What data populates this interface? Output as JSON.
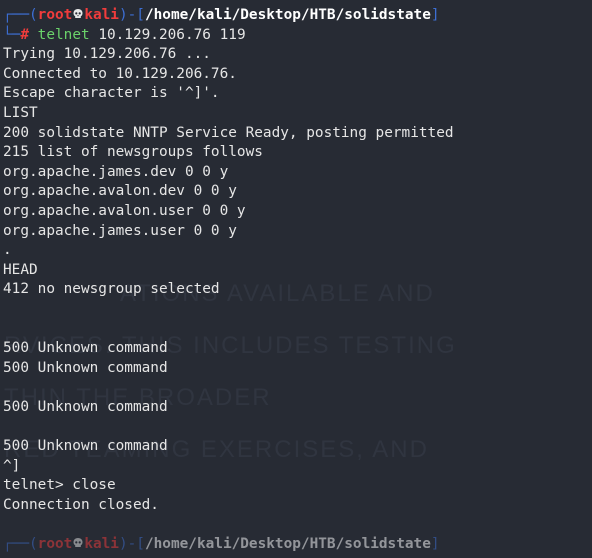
{
  "window": {
    "title": ""
  },
  "prompt": {
    "top_box": "┌──(",
    "user": "root",
    "host": "kali",
    "close_paren": ")-[",
    "path": "/home/kali/Desktop/HTB/solidstate",
    "close_bracket": "]",
    "bottom_box": "└─",
    "hash": "#",
    "command": "telnet",
    "args": " 10.129.206.76 119"
  },
  "output_lines": [
    "Trying 10.129.206.76 ...",
    "Connected to 10.129.206.76.",
    "Escape character is '^]'.",
    "LIST",
    "200 solidstate NNTP Service Ready, posting permitted",
    "215 list of newsgroups follows",
    "org.apache.james.dev 0 0 y",
    "org.apache.avalon.dev 0 0 y",
    "org.apache.avalon.user 0 0 y",
    "org.apache.james.user 0 0 y",
    ".",
    "HEAD",
    "412 no newsgroup selected",
    "",
    "",
    "500 Unknown command",
    "500 Unknown command",
    "",
    "500 Unknown command",
    "",
    "500 Unknown command",
    "^]",
    "telnet> close",
    "Connection closed."
  ],
  "bottom_prompt": {
    "top_box": "┌──(",
    "user": "root",
    "host": "kali",
    "close_paren": ")-[",
    "path": "/home/kali/Desktop/HTB/solidstate",
    "close_bracket": "]"
  },
  "watermark_lines": [
    "ATIONS AVAILABLE AND",
    "RVICES. THIS INCLUDES TESTING",
    "THIN THE BROADER",
    "RED TEAMING EXERCISES, AND"
  ],
  "colors": {
    "background": "#272b34",
    "prompt_box": "#3d6fd4",
    "prompt_user": "#f03c3c",
    "command": "#6ad26a",
    "text": "#e6e6e6"
  }
}
